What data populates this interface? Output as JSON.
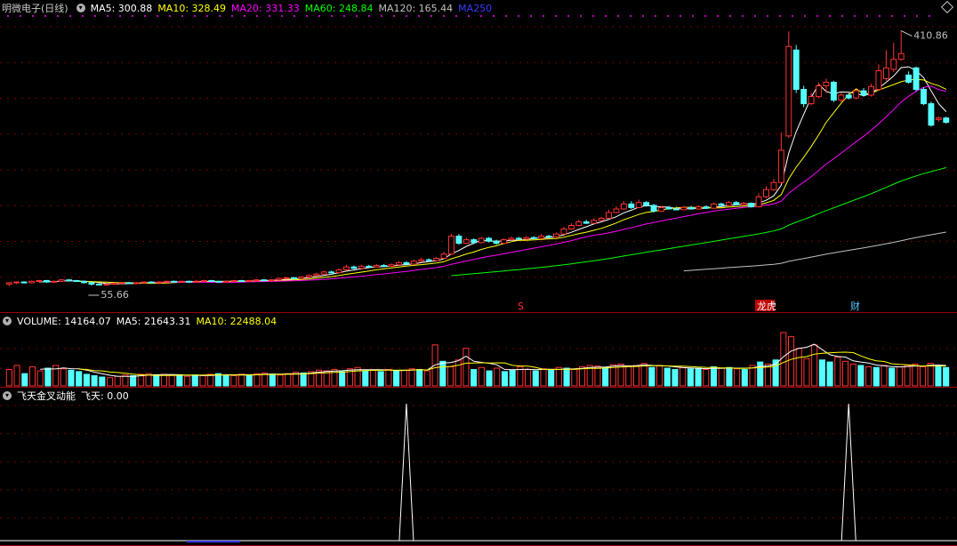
{
  "header": {
    "stock_name": "明微电子(日线)",
    "ma5": "MA5: 300.88",
    "ma10": "MA10: 328.49",
    "ma20": "MA20: 331.33",
    "ma60": "MA60: 248.84",
    "ma120": "MA120: 165.44",
    "ma250": "MA250",
    "high_label": "410.86",
    "low_label": "55.66",
    "event_s": "S",
    "event_lhb": "龙虎",
    "event_cai": "财"
  },
  "volume_header": {
    "volume": "VOLUME: 14164.07",
    "ma5": "MA5: 21643.31",
    "ma10": "MA10: 22488.04"
  },
  "indicator_header": {
    "name": "飞天金叉动能",
    "value": "飞天: 0.00"
  },
  "colors": {
    "up": "#ff3232",
    "down": "#54ffff",
    "ma5": "#ffffff",
    "ma10": "#ffff00",
    "ma20": "#ff00ff",
    "ma60": "#00ff00",
    "ma120": "#c0c0c0",
    "ma250": "#3a3aff",
    "grid": "#7a0000"
  },
  "chart_data": [
    {
      "type": "candlestick",
      "title": "明微电子(日线)",
      "high_marker": 410.86,
      "low_marker": 55.66,
      "ylim": [
        45,
        430
      ],
      "description_of_series": "daily candles estimated from the picture",
      "candles": [
        [
          58,
          60,
          55,
          61
        ],
        [
          60,
          61,
          58,
          62
        ],
        [
          61,
          60,
          59,
          62
        ],
        [
          60,
          62,
          59,
          63
        ],
        [
          62,
          63,
          61,
          64
        ],
        [
          63,
          61,
          60,
          64
        ],
        [
          61,
          62,
          60,
          63
        ],
        [
          62,
          64,
          61,
          65
        ],
        [
          64,
          63,
          62,
          65
        ],
        [
          63,
          62,
          61,
          64
        ],
        [
          62,
          60,
          59,
          63
        ],
        [
          60,
          58,
          56,
          61
        ],
        [
          58,
          57,
          56,
          59
        ],
        [
          57,
          58,
          56,
          59
        ],
        [
          58,
          59,
          57,
          60
        ],
        [
          59,
          60,
          58,
          61
        ],
        [
          60,
          59,
          58,
          61
        ],
        [
          59,
          60,
          58,
          61
        ],
        [
          60,
          61,
          59,
          62
        ],
        [
          61,
          60,
          59,
          62
        ],
        [
          60,
          61,
          59,
          62
        ],
        [
          61,
          62,
          60,
          63
        ],
        [
          62,
          61,
          60,
          63
        ],
        [
          61,
          62,
          60,
          63
        ],
        [
          62,
          61,
          60,
          63
        ],
        [
          61,
          62,
          60,
          64
        ],
        [
          62,
          63,
          61,
          64
        ],
        [
          63,
          62,
          61,
          64
        ],
        [
          62,
          61,
          60,
          63
        ],
        [
          61,
          62,
          60,
          63
        ],
        [
          62,
          63,
          61,
          64
        ],
        [
          63,
          62,
          61,
          64
        ],
        [
          62,
          63,
          61,
          64
        ],
        [
          63,
          64,
          62,
          65
        ],
        [
          64,
          63,
          62,
          65
        ],
        [
          63,
          64,
          62,
          65
        ],
        [
          64,
          66,
          63,
          67
        ],
        [
          66,
          67,
          65,
          68
        ],
        [
          67,
          66,
          65,
          68
        ],
        [
          66,
          68,
          65,
          69
        ],
        [
          68,
          70,
          67,
          72
        ],
        [
          70,
          72,
          69,
          74
        ],
        [
          72,
          75,
          71,
          77
        ],
        [
          75,
          74,
          73,
          77
        ],
        [
          74,
          78,
          73,
          80
        ],
        [
          78,
          82,
          77,
          85
        ],
        [
          82,
          80,
          79,
          84
        ],
        [
          80,
          83,
          79,
          85
        ],
        [
          83,
          82,
          81,
          85
        ],
        [
          82,
          84,
          81,
          86
        ],
        [
          84,
          83,
          82,
          86
        ],
        [
          83,
          85,
          82,
          87
        ],
        [
          85,
          88,
          84,
          90
        ],
        [
          88,
          86,
          85,
          90
        ],
        [
          86,
          90,
          85,
          92
        ],
        [
          90,
          92,
          89,
          95
        ],
        [
          92,
          91,
          90,
          94
        ],
        [
          91,
          94,
          90,
          96
        ],
        [
          94,
          100,
          93,
          103
        ],
        [
          100,
          125,
          99,
          128
        ],
        [
          125,
          115,
          113,
          128
        ],
        [
          115,
          120,
          114,
          123
        ],
        [
          120,
          116,
          114,
          122
        ],
        [
          116,
          122,
          115,
          124
        ],
        [
          122,
          118,
          116,
          124
        ],
        [
          118,
          115,
          113,
          120
        ],
        [
          115,
          120,
          114,
          122
        ],
        [
          120,
          122,
          119,
          124
        ],
        [
          122,
          121,
          120,
          124
        ],
        [
          121,
          123,
          120,
          125
        ],
        [
          123,
          122,
          121,
          125
        ],
        [
          122,
          125,
          121,
          128
        ],
        [
          125,
          124,
          123,
          127
        ],
        [
          124,
          128,
          123,
          130
        ],
        [
          128,
          135,
          127,
          138
        ],
        [
          135,
          140,
          134,
          143
        ],
        [
          140,
          145,
          139,
          148
        ],
        [
          145,
          143,
          142,
          148
        ],
        [
          143,
          147,
          142,
          150
        ],
        [
          147,
          150,
          146,
          152
        ],
        [
          150,
          158,
          149,
          162
        ],
        [
          158,
          163,
          157,
          167
        ],
        [
          163,
          170,
          162,
          174
        ],
        [
          170,
          165,
          163,
          174
        ],
        [
          165,
          172,
          164,
          176
        ],
        [
          172,
          168,
          166,
          174
        ],
        [
          168,
          160,
          158,
          170
        ],
        [
          160,
          165,
          159,
          167
        ],
        [
          165,
          163,
          162,
          167
        ],
        [
          163,
          162,
          161,
          166
        ],
        [
          162,
          165,
          161,
          166
        ],
        [
          165,
          163,
          162,
          167
        ],
        [
          163,
          166,
          162,
          168
        ],
        [
          166,
          164,
          163,
          168
        ],
        [
          164,
          170,
          163,
          172
        ],
        [
          170,
          168,
          167,
          172
        ],
        [
          168,
          172,
          167,
          174
        ],
        [
          172,
          169,
          168,
          174
        ],
        [
          169,
          171,
          168,
          173
        ],
        [
          171,
          166,
          165,
          172
        ],
        [
          166,
          180,
          165,
          185
        ],
        [
          180,
          190,
          178,
          195
        ],
        [
          190,
          200,
          188,
          205
        ],
        [
          200,
          245,
          198,
          270
        ],
        [
          265,
          390,
          262,
          411
        ],
        [
          385,
          330,
          325,
          392
        ],
        [
          330,
          310,
          305,
          335
        ],
        [
          310,
          320,
          308,
          325
        ],
        [
          320,
          335,
          318,
          340
        ],
        [
          335,
          340,
          325,
          345
        ],
        [
          340,
          315,
          312,
          342
        ],
        [
          315,
          322,
          312,
          326
        ],
        [
          322,
          318,
          316,
          325
        ],
        [
          318,
          328,
          316,
          330
        ],
        [
          328,
          322,
          320,
          332
        ],
        [
          322,
          334,
          320,
          338
        ],
        [
          330,
          356,
          328,
          365
        ],
        [
          345,
          360,
          342,
          385
        ],
        [
          358,
          372,
          354,
          395
        ],
        [
          372,
          380,
          370,
          412
        ],
        [
          350,
          340,
          338,
          355
        ],
        [
          360,
          330,
          327,
          362
        ],
        [
          330,
          310,
          308,
          333
        ],
        [
          310,
          280,
          278,
          313
        ],
        [
          288,
          290,
          285,
          292
        ],
        [
          290,
          284,
          282,
          292
        ]
      ],
      "ma_lines": {
        "MA5": 300.88,
        "MA10": 328.49,
        "MA20": 331.33,
        "MA60": 248.84,
        "MA120": 165.44
      }
    },
    {
      "type": "bar",
      "title": "VOLUME",
      "values": [
        24,
        30,
        18,
        28,
        22,
        26,
        30,
        25,
        23,
        21,
        17,
        15,
        13,
        12,
        14,
        16,
        15,
        17,
        18,
        16,
        17,
        16,
        15,
        14,
        16,
        15,
        17,
        18,
        16,
        15,
        17,
        16,
        18,
        19,
        17,
        16,
        18,
        20,
        19,
        21,
        23,
        22,
        24,
        21,
        25,
        27,
        22,
        23,
        21,
        24,
        22,
        23,
        25,
        24,
        22,
        60,
        36,
        28,
        38,
        55,
        24,
        27,
        22,
        26,
        21,
        23,
        28,
        24,
        22,
        25,
        23,
        27,
        26,
        24,
        28,
        30,
        29,
        27,
        31,
        32,
        28,
        30,
        33,
        27,
        30,
        26,
        24,
        27,
        25,
        26,
        24,
        28,
        26,
        27,
        25,
        24,
        30,
        35,
        32,
        38,
        78,
        72,
        55,
        40,
        60,
        38,
        35,
        42,
        36,
        32,
        30,
        28,
        27,
        30,
        26,
        28,
        30,
        32,
        28,
        33,
        30,
        27
      ],
      "value_labels": {
        "VOLUME": 14164.07,
        "MA5": 21643.31,
        "MA10": 22488.04
      }
    },
    {
      "type": "line",
      "title": "飞天金叉动能",
      "series": [
        {
          "name": "飞天",
          "current": 0.0,
          "spikes_at": [
            53,
            112
          ]
        }
      ]
    }
  ]
}
